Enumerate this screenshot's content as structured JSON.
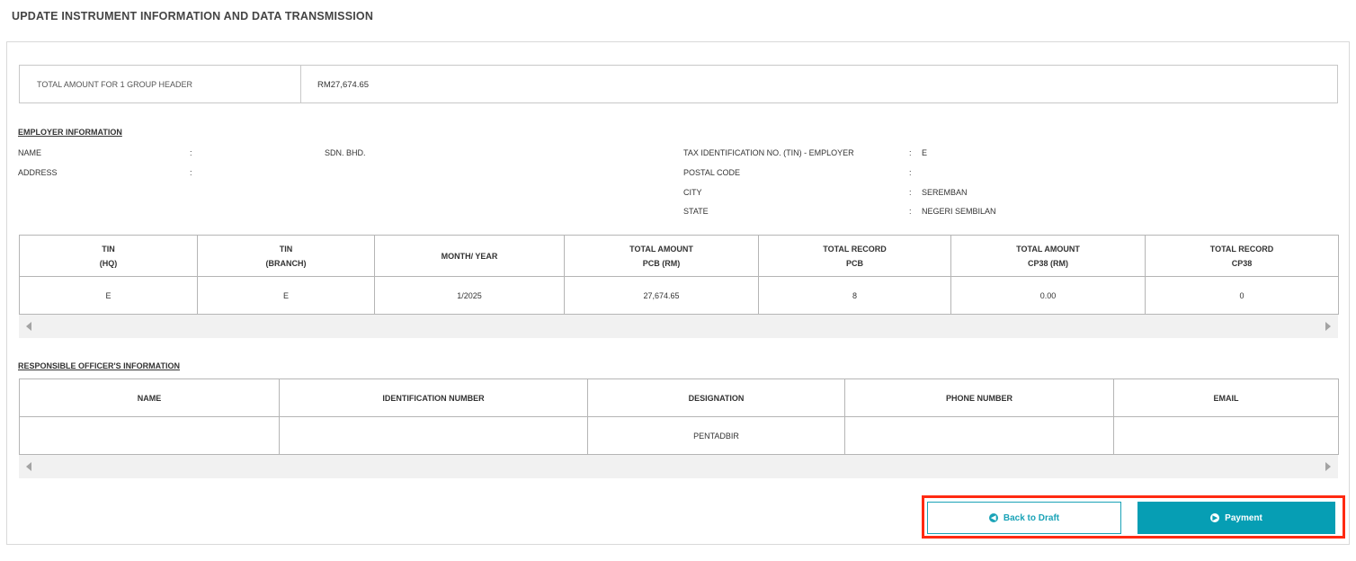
{
  "page": {
    "title": "UPDATE INSTRUMENT INFORMATION AND DATA TRANSMISSION"
  },
  "summary": {
    "label": "TOTAL AMOUNT FOR 1 GROUP HEADER",
    "value": "RM27,674.65"
  },
  "employer": {
    "heading": "EMPLOYER INFORMATION",
    "name_label": "NAME",
    "name_value": "SDN. BHD.",
    "address_label": "ADDRESS",
    "address_value": "",
    "tin_label": "TAX IDENTIFICATION NO. (TIN) - EMPLOYER",
    "tin_value": "E",
    "postal_label": "POSTAL CODE",
    "postal_value": "",
    "city_label": "CITY",
    "city_value": "SEREMBAN",
    "state_label": "STATE",
    "state_value": "NEGERI SEMBILAN",
    "colon": ":"
  },
  "summary_table": {
    "headers": [
      [
        "TIN",
        "(HQ)"
      ],
      [
        "TIN",
        "(BRANCH)"
      ],
      [
        "MONTH/ YEAR",
        ""
      ],
      [
        "TOTAL AMOUNT",
        "PCB (RM)"
      ],
      [
        "TOTAL RECORD",
        "PCB"
      ],
      [
        "TOTAL AMOUNT",
        "CP38 (RM)"
      ],
      [
        "TOTAL RECORD",
        "CP38"
      ]
    ],
    "row": [
      "E",
      "E",
      "1/2025",
      "27,674.65",
      "8",
      "0.00",
      "0"
    ]
  },
  "officer": {
    "heading": "RESPONSIBLE OFFICER'S INFORMATION",
    "headers": [
      "NAME",
      "IDENTIFICATION NUMBER",
      "DESIGNATION",
      "PHONE NUMBER",
      "EMAIL"
    ],
    "row": [
      "",
      "",
      "PENTADBIR",
      "",
      ""
    ]
  },
  "actions": {
    "back_label": "Back to Draft",
    "payment_label": "Payment"
  },
  "colors": {
    "accent": "#069eb4",
    "highlight": "#ff2a12"
  },
  "icons": {
    "back": "arrow-left-circle-icon",
    "payment": "arrow-right-circle-icon"
  }
}
